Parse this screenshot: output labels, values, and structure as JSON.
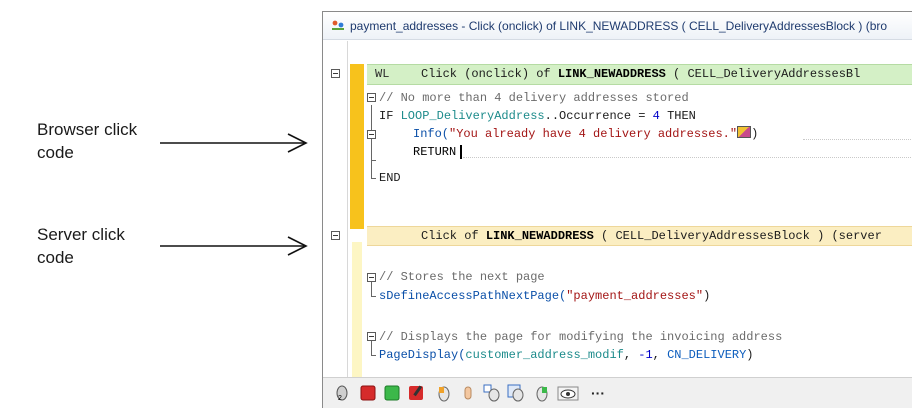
{
  "annotations": {
    "browser": {
      "line1": "Browser click",
      "line2": "code"
    },
    "server": {
      "line1": "Server click",
      "line2": "code"
    }
  },
  "window": {
    "title": "payment_addresses - Click (onclick) of LINK_NEWADDRESS ( CELL_DeliveryAddressesBlock ) (bro"
  },
  "browser_section": {
    "wl_tag": "WL",
    "header_prefix": "Click (onclick) of ",
    "header_control": "LINK_NEWADDRESS",
    "header_suffix": " ( CELL_DeliveryAddressesBl",
    "comment": "// No more than 4 delivery addresses stored",
    "if_kw": "IF",
    "if_var": "LOOP_DeliveryAddress",
    "if_rest": "..Occurrence = ",
    "if_num": "4",
    "then_kw": " THEN",
    "info_fn": "Info(",
    "info_str": "\"You already have 4 delivery addresses.\"",
    "info_close": ")",
    "return_kw": "RETURN",
    "end_kw": "END"
  },
  "server_section": {
    "header_prefix": "Click of ",
    "header_control": "LINK_NEWADDRESS",
    "header_suffix": " ( CELL_DeliveryAddressesBlock ) (server",
    "comment1": "// Stores the next page",
    "call1_fn": "sDefineAccessPathNextPage(",
    "call1_str": "\"payment_addresses\"",
    "call1_close": ")",
    "comment2": "// Displays the page for modifying the invoicing address",
    "call2_fn": "PageDisplay(",
    "call2_arg1": "customer_address_modif",
    "call2_sep1": ", ",
    "call2_num": "-1",
    "call2_sep2": ", ",
    "call2_const": "CN_DELIVERY",
    "call2_close": ")"
  },
  "toolbar": {
    "more_label": "···"
  },
  "colors": {
    "accent_yellow": "#f7c21c",
    "browser_header": "#d4f0c6",
    "server_header": "#fbeec2"
  }
}
